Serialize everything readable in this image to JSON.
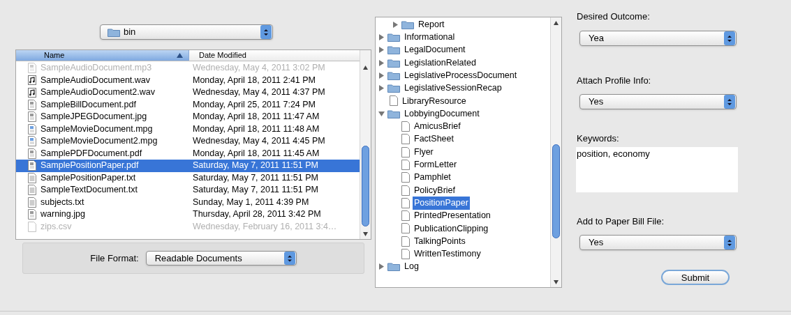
{
  "folder_popup": {
    "value": "bin"
  },
  "file_list": {
    "columns": [
      {
        "label": "Name",
        "sorted": true
      },
      {
        "label": "Date Modified",
        "sorted": false
      }
    ],
    "rows": [
      {
        "name": "SampleAudioDocument.mp3",
        "date": "Wednesday, May 4, 2011 3:02 PM",
        "kind": "doc",
        "disabled": true,
        "selected": false
      },
      {
        "name": "SampleAudioDocument.wav",
        "date": "Monday, April 18, 2011 2:41 PM",
        "kind": "audio",
        "disabled": false,
        "selected": false
      },
      {
        "name": "SampleAudioDocument2.wav",
        "date": "Wednesday, May 4, 2011 4:37 PM",
        "kind": "audio",
        "disabled": false,
        "selected": false
      },
      {
        "name": "SampleBillDocument.pdf",
        "date": "Monday, April 25, 2011 7:24 PM",
        "kind": "doc",
        "disabled": false,
        "selected": false
      },
      {
        "name": "SampleJPEGDocument.jpg",
        "date": "Monday, April 18, 2011 11:47 AM",
        "kind": "doc",
        "disabled": false,
        "selected": false
      },
      {
        "name": "SampleMovieDocument.mpg",
        "date": "Monday, April 18, 2011 11:48 AM",
        "kind": "movie",
        "disabled": false,
        "selected": false
      },
      {
        "name": "SampleMovieDocument2.mpg",
        "date": "Wednesday, May 4, 2011 4:45 PM",
        "kind": "movie",
        "disabled": false,
        "selected": false
      },
      {
        "name": "SamplePDFDocument.pdf",
        "date": "Monday, April 18, 2011 11:45 AM",
        "kind": "doc",
        "disabled": false,
        "selected": false
      },
      {
        "name": "SamplePositionPaper.pdf",
        "date": "Saturday, May 7, 2011 11:51 PM",
        "kind": "doc",
        "disabled": false,
        "selected": true
      },
      {
        "name": "SamplePositionPaper.txt",
        "date": "Saturday, May 7, 2011 11:51 PM",
        "kind": "text",
        "disabled": false,
        "selected": false
      },
      {
        "name": "SampleTextDocument.txt",
        "date": "Saturday, May 7, 2011 11:51 PM",
        "kind": "text",
        "disabled": false,
        "selected": false
      },
      {
        "name": "subjects.txt",
        "date": "Sunday, May 1, 2011 4:39 PM",
        "kind": "text",
        "disabled": false,
        "selected": false
      },
      {
        "name": "warning.jpg",
        "date": "Thursday, April 28, 2011 3:42 PM",
        "kind": "doc",
        "disabled": false,
        "selected": false
      },
      {
        "name": "zips.csv",
        "date": "Wednesday, February 16, 2011 3:4…",
        "kind": "blank",
        "disabled": true,
        "selected": false
      }
    ]
  },
  "file_format": {
    "label": "File Format:",
    "value": "Readable Documents"
  },
  "tree": [
    {
      "kind": "unseen-parent",
      "children": [
        {
          "kind": "folder",
          "label": "Report",
          "expanded": false,
          "selected": false
        }
      ]
    },
    {
      "kind": "folder",
      "label": "Informational",
      "expanded": false,
      "selected": false
    },
    {
      "kind": "folder",
      "label": "LegalDocument",
      "expanded": false,
      "selected": false
    },
    {
      "kind": "folder",
      "label": "LegislationRelated",
      "expanded": false,
      "selected": false
    },
    {
      "kind": "folder",
      "label": "LegislativeProcessDocument",
      "expanded": false,
      "selected": false
    },
    {
      "kind": "folder",
      "label": "LegislativeSessionRecap",
      "expanded": false,
      "selected": false
    },
    {
      "kind": "file",
      "label": "LibraryResource",
      "selected": false
    },
    {
      "kind": "folder",
      "label": "LobbyingDocument",
      "expanded": true,
      "selected": false,
      "children": [
        {
          "kind": "file",
          "label": "AmicusBrief",
          "selected": false
        },
        {
          "kind": "file",
          "label": "FactSheet",
          "selected": false
        },
        {
          "kind": "file",
          "label": "Flyer",
          "selected": false
        },
        {
          "kind": "file",
          "label": "FormLetter",
          "selected": false
        },
        {
          "kind": "file",
          "label": "Pamphlet",
          "selected": false
        },
        {
          "kind": "file",
          "label": "PolicyBrief",
          "selected": false
        },
        {
          "kind": "file",
          "label": "PositionPaper",
          "selected": true
        },
        {
          "kind": "file",
          "label": "PrintedPresentation",
          "selected": false
        },
        {
          "kind": "file",
          "label": "PublicationClipping",
          "selected": false
        },
        {
          "kind": "file",
          "label": "TalkingPoints",
          "selected": false
        },
        {
          "kind": "file",
          "label": "WrittenTestimony",
          "selected": false
        }
      ]
    },
    {
      "kind": "folder",
      "label": "Log",
      "expanded": false,
      "selected": false
    }
  ],
  "form": [
    {
      "kind": "popup",
      "label": "Desired Outcome:",
      "value": "Yea"
    },
    {
      "kind": "popup",
      "label": "Attach Profile Info:",
      "value": "Yes"
    },
    {
      "kind": "textarea",
      "label": "Keywords:",
      "value": "position, economy"
    },
    {
      "kind": "popup",
      "label": "Add to Paper Bill File:",
      "value": "Yes"
    }
  ],
  "submit_button": "Submit"
}
